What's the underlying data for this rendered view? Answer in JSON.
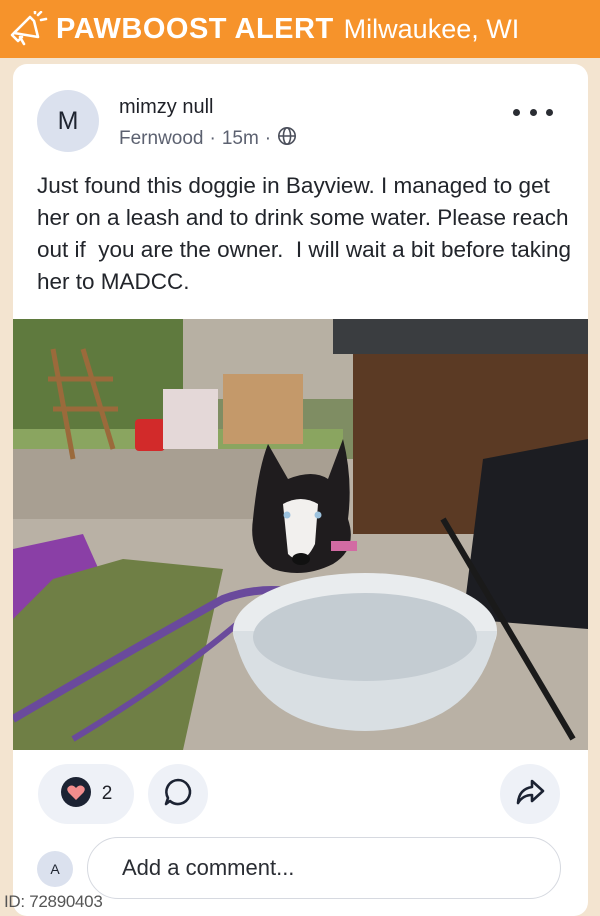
{
  "header": {
    "brand": "PAWBOOST ALERT",
    "location": "Milwaukee, WI",
    "icon": "megaphone-icon",
    "color": "#f6932b"
  },
  "post": {
    "avatar_letter": "M",
    "username": "mimzy null",
    "location": "Fernwood",
    "time": "15m",
    "visibility_icon": "globe-icon",
    "text": "Just found this doggie in Bayview. I managed to get her on a leash and to drink some water. Please reach out if  you are the owner.  I will wait a bit before taking her to MADCC.",
    "likes": "2"
  },
  "comment": {
    "avatar_letter": "A",
    "placeholder": "Add a comment..."
  },
  "footer": {
    "id": "ID: 72890403"
  }
}
